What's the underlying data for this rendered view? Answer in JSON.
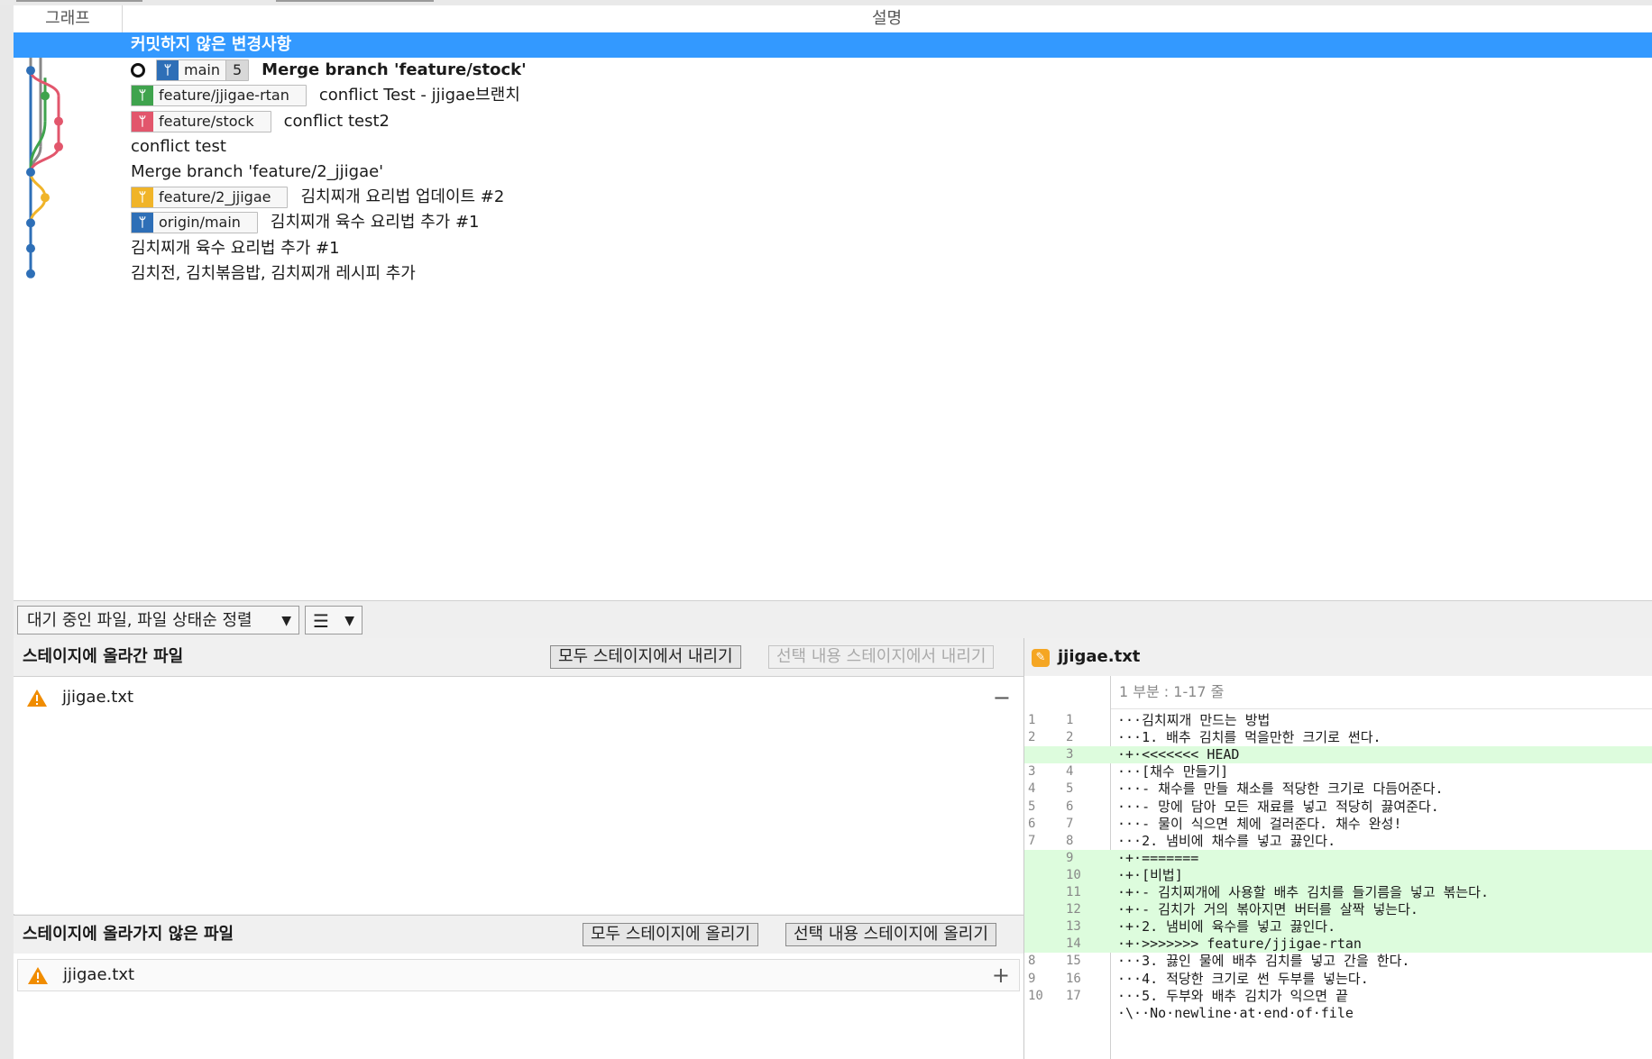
{
  "columns": {
    "graph": "그래프",
    "description": "설명"
  },
  "commits": [
    {
      "text": "커밋하지 않은 변경사항",
      "selected": true,
      "badges": []
    },
    {
      "ring": true,
      "badges": [
        {
          "label": "main",
          "color": "#2e6fb7",
          "count": "5"
        }
      ],
      "text": "Merge branch 'feature/stock'",
      "bold": true
    },
    {
      "badges": [
        {
          "label": "feature/jjigae-rtan",
          "color": "#3fa34d"
        }
      ],
      "text": "conflict Test - jjigae브랜치"
    },
    {
      "badges": [
        {
          "label": "feature/stock",
          "color": "#e2566c"
        }
      ],
      "text": "conflict test2"
    },
    {
      "badges": [],
      "text": "conflict test"
    },
    {
      "badges": [],
      "text": "Merge branch 'feature/2_jjigae'"
    },
    {
      "badges": [
        {
          "label": "feature/2_jjigae",
          "color": "#f0b429"
        }
      ],
      "text": "김치찌개 요리법 업데이트 #2"
    },
    {
      "badges": [
        {
          "label": "origin/main",
          "color": "#2e6fb7"
        }
      ],
      "text": "김치찌개 육수 요리법 추가 #1"
    },
    {
      "badges": [],
      "text": "김치찌개 육수 요리법 추가 #1"
    },
    {
      "badges": [],
      "text": "김치전, 김치볶음밥, 김치찌개 레시피 추가"
    }
  ],
  "toolbar": {
    "sort_label": "대기 중인 파일, 파일 상태순 정렬",
    "list_icon": "list-icon"
  },
  "staged": {
    "title": "스테이지에 올라간 파일",
    "unstage_all": "모두 스테이지에서 내리기",
    "unstage_selected": "선택 내용 스테이지에서 내리기",
    "files": [
      {
        "name": "jjigae.txt",
        "icon": "warning-icon"
      }
    ]
  },
  "unstaged": {
    "title": "스테이지에 올라가지 않은 파일",
    "stage_all": "모두 스테이지에 올리기",
    "stage_selected": "선택 내용 스테이지에 올리기",
    "files": [
      {
        "name": "jjigae.txt",
        "icon": "warning-icon"
      }
    ]
  },
  "diff": {
    "filename": "jjigae.txt",
    "hunk_header": "1 부분 : 1-17 줄",
    "lines": [
      {
        "old": "1",
        "new": "1",
        "type": "ctx",
        "text": "···김치찌개 만드는 방법"
      },
      {
        "old": "2",
        "new": "2",
        "type": "ctx",
        "text": "···1. 배추 김치를 먹을만한 크기로 썬다."
      },
      {
        "old": "",
        "new": "3",
        "type": "add",
        "text": "·+·<<<<<<< HEAD"
      },
      {
        "old": "3",
        "new": "4",
        "type": "ctx",
        "text": "···[채수 만들기]"
      },
      {
        "old": "4",
        "new": "5",
        "type": "ctx",
        "text": "···- 채수를 만들 채소를 적당한 크기로 다듬어준다."
      },
      {
        "old": "5",
        "new": "6",
        "type": "ctx",
        "text": "···- 망에 담아 모든 재료를 넣고 적당히 끓여준다."
      },
      {
        "old": "6",
        "new": "7",
        "type": "ctx",
        "text": "···- 물이 식으면 체에 걸러준다. 채수 완성!"
      },
      {
        "old": "7",
        "new": "8",
        "type": "ctx",
        "text": "···2. 냄비에 채수를 넣고 끓인다."
      },
      {
        "old": "",
        "new": "9",
        "type": "add",
        "text": "·+·======="
      },
      {
        "old": "",
        "new": "10",
        "type": "add",
        "text": "·+·[비법]"
      },
      {
        "old": "",
        "new": "11",
        "type": "add",
        "text": "·+·- 김치찌개에 사용할 배추 김치를 들기름을 넣고 볶는다."
      },
      {
        "old": "",
        "new": "12",
        "type": "add",
        "text": "·+·- 김치가 거의 볶아지면 버터를 살짝 넣는다."
      },
      {
        "old": "",
        "new": "13",
        "type": "add",
        "text": "·+·2. 냄비에 육수를 넣고 끓인다."
      },
      {
        "old": "",
        "new": "14",
        "type": "add",
        "text": "·+·>>>>>>> feature/jjigae-rtan"
      },
      {
        "old": "8",
        "new": "15",
        "type": "ctx",
        "text": "···3. 끓인 물에 배추 김치를 넣고 간을 한다."
      },
      {
        "old": "9",
        "new": "16",
        "type": "ctx",
        "text": "···4. 적당한 크기로 썬 두부를 넣는다."
      },
      {
        "old": "10",
        "new": "17",
        "type": "ctx",
        "text": "···5. 두부와 배추 김치가 익으면 끝"
      },
      {
        "old": "",
        "new": "",
        "type": "ctx",
        "text": "·\\··No·newline·at·end·of·file"
      }
    ]
  }
}
